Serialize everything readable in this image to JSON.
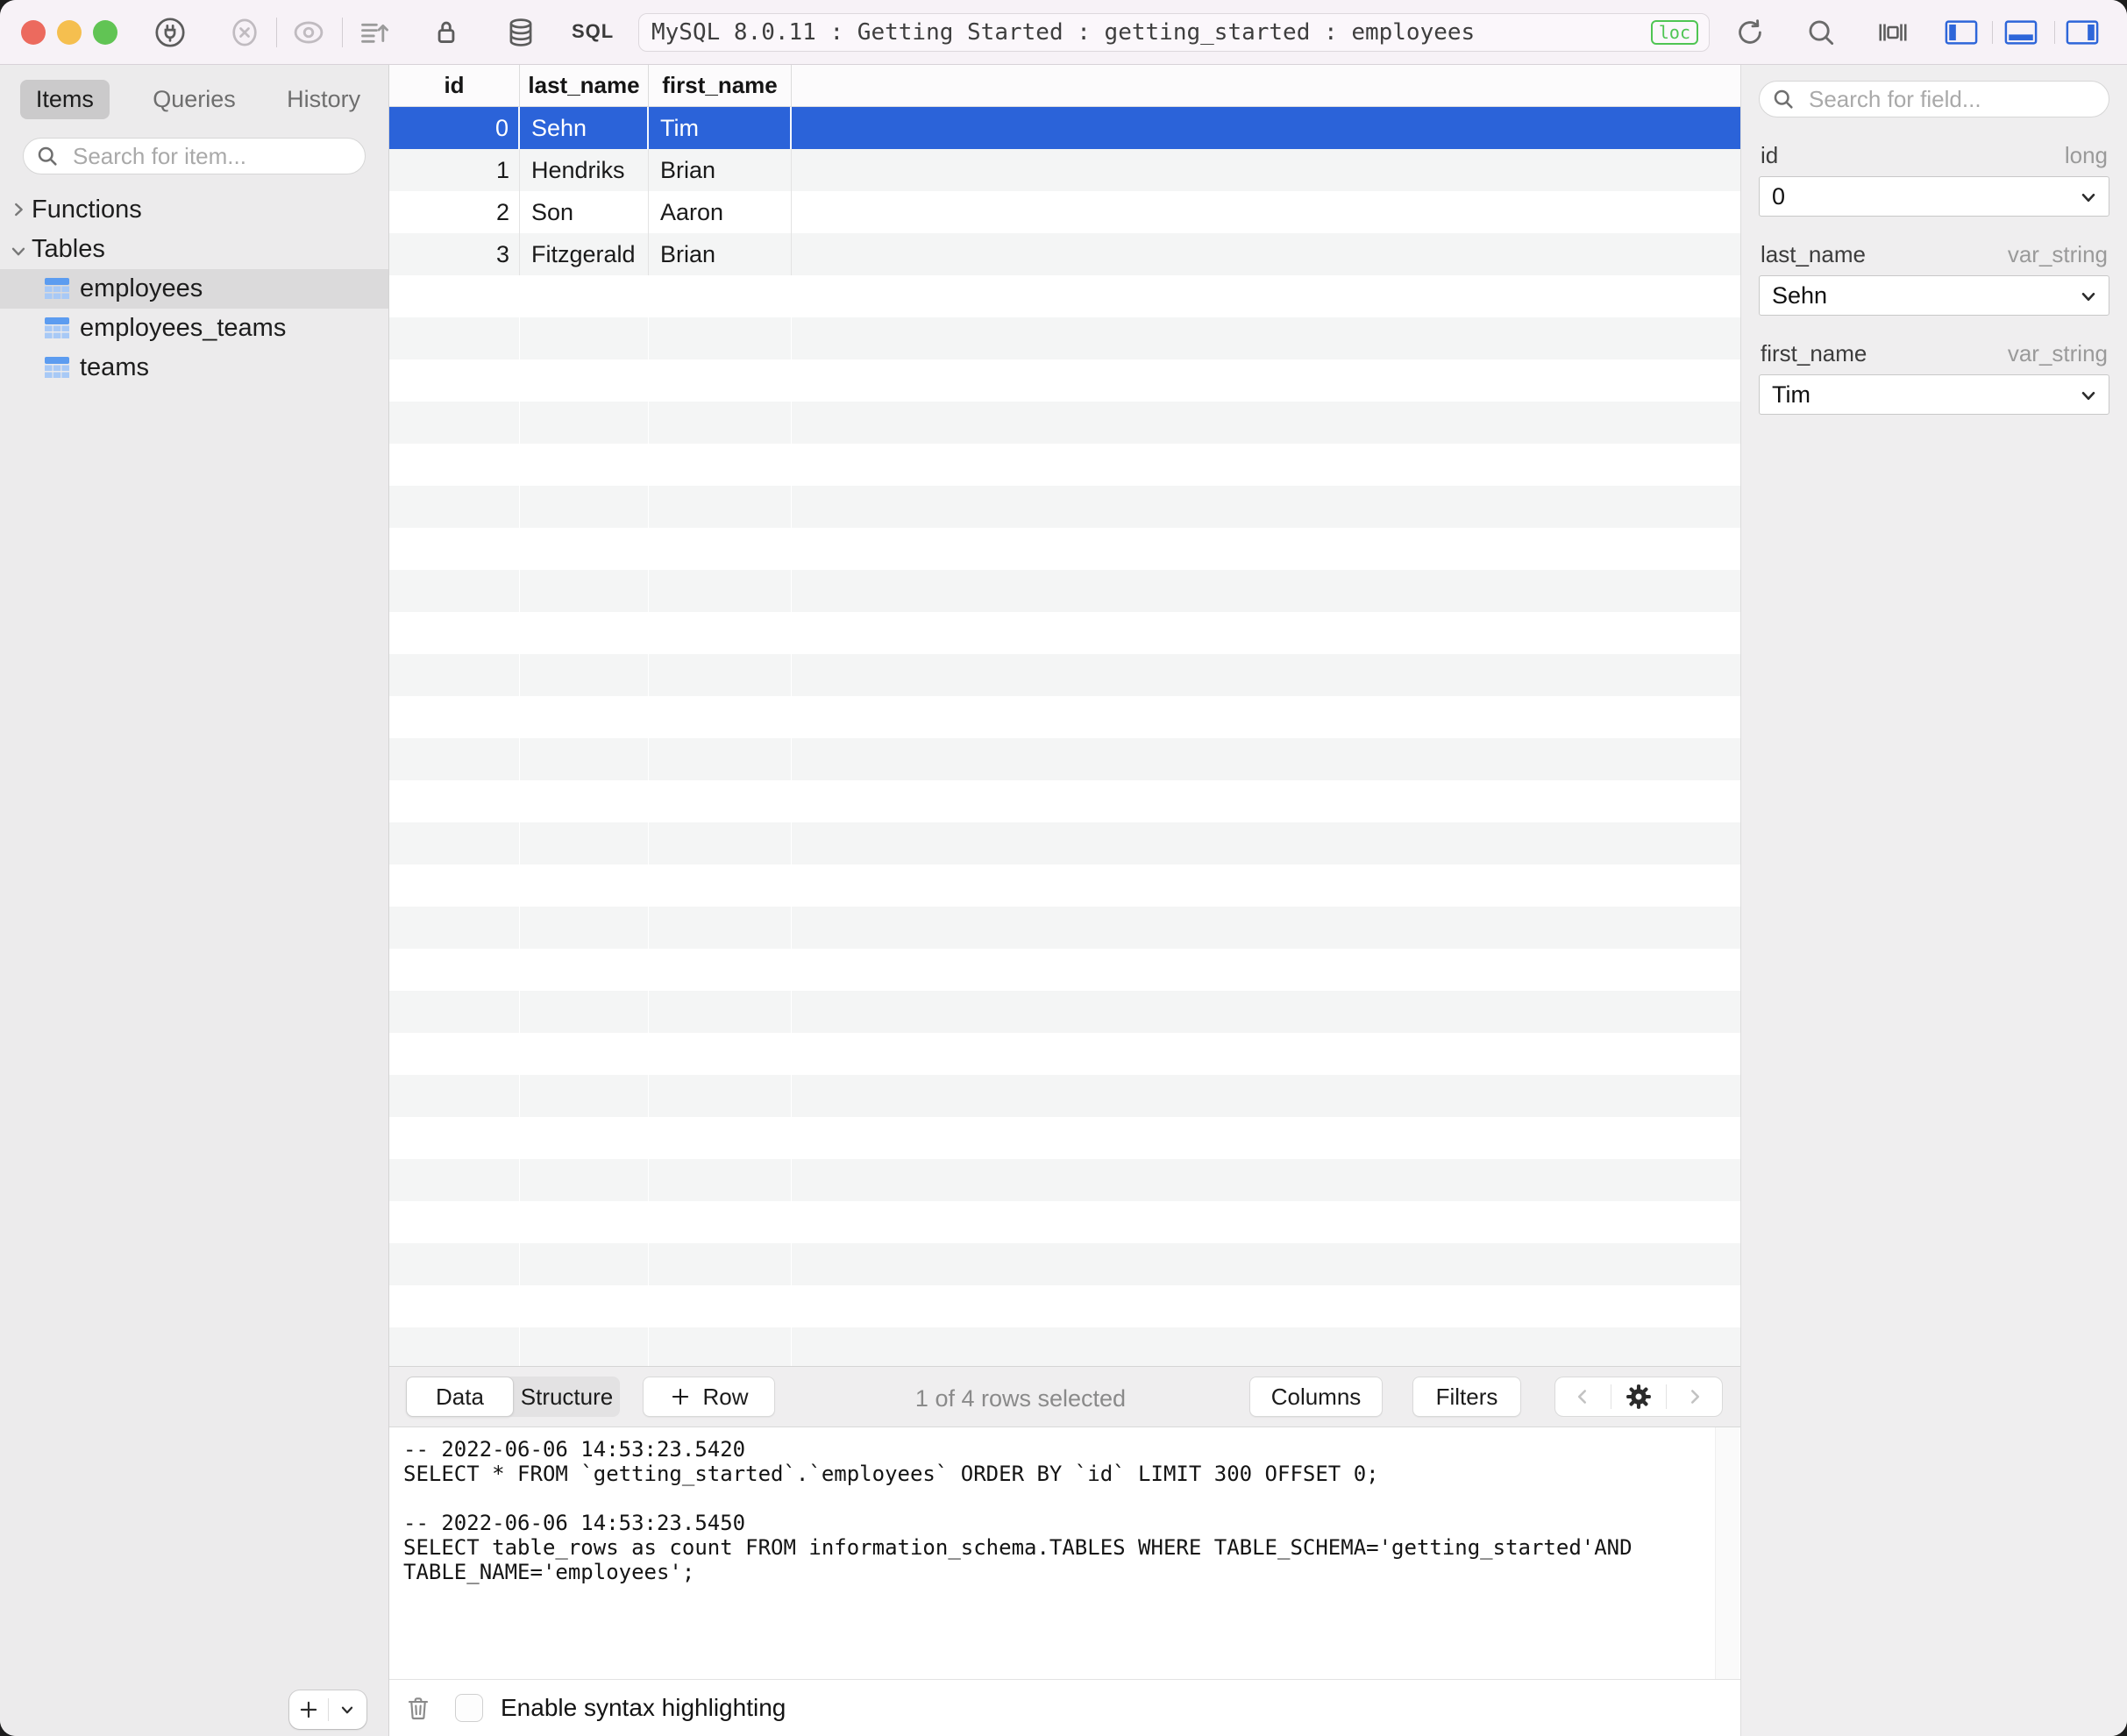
{
  "window": {
    "title_text": "MySQL 8.0.11 : Getting Started : getting_started : employees",
    "loc_badge": "loc"
  },
  "toolbar": {
    "sql_label": "SQL",
    "icons": [
      "connection-plug",
      "cancel-query",
      "visibility",
      "export-dump",
      "lock",
      "database",
      "refresh",
      "search",
      "console-drawer",
      "toggle-left-panel",
      "toggle-bottom-panel",
      "toggle-right-panel"
    ]
  },
  "colors": {
    "accent_blue": "#2B63D9",
    "loc_green": "#4FC553",
    "stripe_gray": "#F4F5F5",
    "toolbar_pink": "#F7F2F7"
  },
  "sidebar": {
    "tabs": [
      {
        "label": "Items",
        "active": true
      },
      {
        "label": "Queries",
        "active": false
      },
      {
        "label": "History",
        "active": false
      }
    ],
    "search_placeholder": "Search for item...",
    "tree": {
      "functions_label": "Functions",
      "tables_label": "Tables",
      "tables": [
        {
          "name": "employees",
          "selected": true
        },
        {
          "name": "employees_teams",
          "selected": false
        },
        {
          "name": "teams",
          "selected": false
        }
      ]
    }
  },
  "grid": {
    "columns": [
      "id",
      "last_name",
      "first_name"
    ],
    "rows": [
      {
        "id": "0",
        "last_name": "Sehn",
        "first_name": "Tim",
        "selected": true
      },
      {
        "id": "1",
        "last_name": "Hendriks",
        "first_name": "Brian",
        "selected": false
      },
      {
        "id": "2",
        "last_name": "Son",
        "first_name": "Aaron",
        "selected": false
      },
      {
        "id": "3",
        "last_name": "Fitzgerald",
        "first_name": "Brian",
        "selected": false
      }
    ],
    "empty_row_count": 26
  },
  "statusbar": {
    "tabs": [
      {
        "label": "Data",
        "active": true
      },
      {
        "label": "Structure",
        "active": false
      }
    ],
    "add_row_label": "Row",
    "selection_text": "1 of 4 rows selected",
    "columns_label": "Columns",
    "filters_label": "Filters"
  },
  "console": {
    "text": "-- 2022-06-06 14:53:23.5420\nSELECT * FROM `getting_started`.`employees` ORDER BY `id` LIMIT 300 OFFSET 0;\n\n-- 2022-06-06 14:53:23.5450\nSELECT table_rows as count FROM information_schema.TABLES WHERE TABLE_SCHEMA='getting_started'AND\nTABLE_NAME='employees';",
    "footer_label": "Enable syntax highlighting"
  },
  "inspector": {
    "search_placeholder": "Search for field...",
    "fields": [
      {
        "name": "id",
        "type": "long",
        "value": "0"
      },
      {
        "name": "last_name",
        "type": "var_string",
        "value": "Sehn"
      },
      {
        "name": "first_name",
        "type": "var_string",
        "value": "Tim"
      }
    ]
  }
}
